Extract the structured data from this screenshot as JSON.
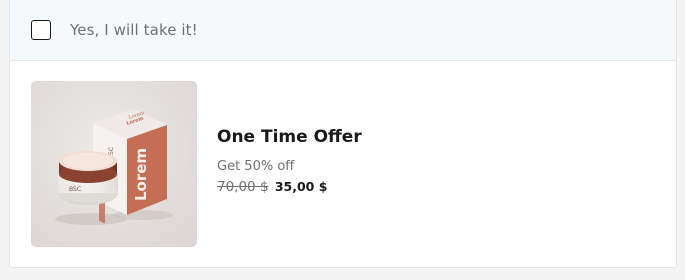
{
  "upsell": {
    "accept_label": "Yes, I will take it!",
    "checkbox_checked": false,
    "product": {
      "image_alt": "Lorem skincare cream jar and box",
      "box_brand_text": "Lorem",
      "jar_label_text": "BSC",
      "title": "One Time Offer",
      "discount_text": "Get 50% off",
      "original_price": "70,00 $",
      "sale_price": "35,00 $"
    }
  },
  "colors": {
    "header_bg": "#f6f9fc",
    "border": "#e3e6ea",
    "text_primary": "#1a1a1a",
    "text_muted": "#707070",
    "box_terracotta": "#c46e56"
  }
}
